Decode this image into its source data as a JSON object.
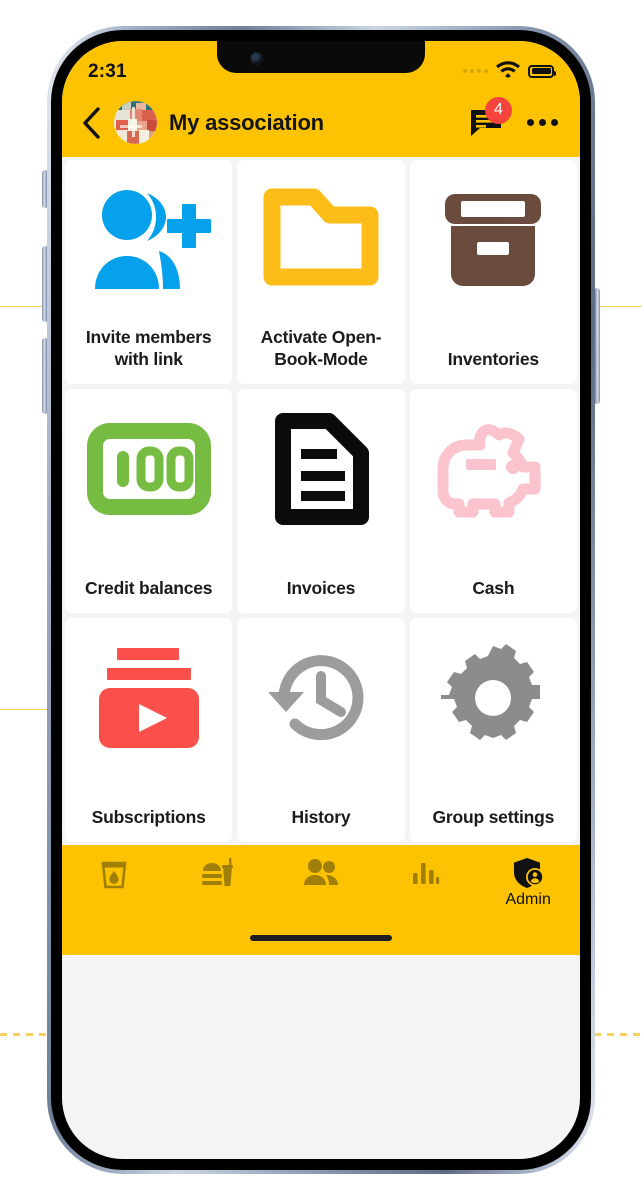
{
  "theme": {
    "brand_yellow": "#FDC300",
    "badge_red": "#F4443B",
    "screen_bg": "#f4f4f5",
    "tile_bg": "#ffffff",
    "text_dark": "#1b1b1b",
    "tab_icon_inactive": "#a07f08",
    "tab_icon_active": "#111111"
  },
  "status_bar": {
    "time": "2:31",
    "signal_icon": "signal-dots-icon",
    "wifi_icon": "wifi-icon",
    "battery_icon": "battery-full-icon"
  },
  "app_bar": {
    "back_icon": "back-chevron-icon",
    "avatar_icon": "group-avatar-photo",
    "title": "My association",
    "messages_icon": "chat-bubble-icon",
    "messages_badge": "4",
    "overflow_icon": "more-horizontal-icon"
  },
  "grid": {
    "tiles": [
      {
        "label": "Invite members with link",
        "icon": "person-add-icon",
        "color": "#06A1EC"
      },
      {
        "label": "Activate Open-Book-Mode",
        "icon": "folder-icon",
        "color": "#FCBD18"
      },
      {
        "label": "Inventories",
        "icon": "archive-box-icon",
        "color": "#6B4B3E"
      },
      {
        "label": "Credit balances",
        "icon": "money-100-icon",
        "color": "#76BC43"
      },
      {
        "label": "Invoices",
        "icon": "document-lines-icon",
        "color": "#0B0B0B"
      },
      {
        "label": "Cash",
        "icon": "piggy-bank-icon",
        "color": "#FBC3CD"
      },
      {
        "label": "Subscriptions",
        "icon": "subscriptions-play-icon",
        "color": "#F9504B"
      },
      {
        "label": "History",
        "icon": "history-clock-icon",
        "color": "#9C9C9C"
      },
      {
        "label": "Group settings",
        "icon": "gear-icon",
        "color": "#8C8C8C"
      }
    ]
  },
  "tab_bar": {
    "items": [
      {
        "label": "",
        "icon": "drink-glass-icon",
        "active": false
      },
      {
        "label": "",
        "icon": "fast-food-icon",
        "active": false
      },
      {
        "label": "",
        "icon": "people-group-icon",
        "active": false
      },
      {
        "label": "",
        "icon": "bar-chart-icon",
        "active": false
      },
      {
        "label": "Admin",
        "icon": "shield-person-icon",
        "active": true
      }
    ]
  },
  "home_indicator": "home-bar"
}
